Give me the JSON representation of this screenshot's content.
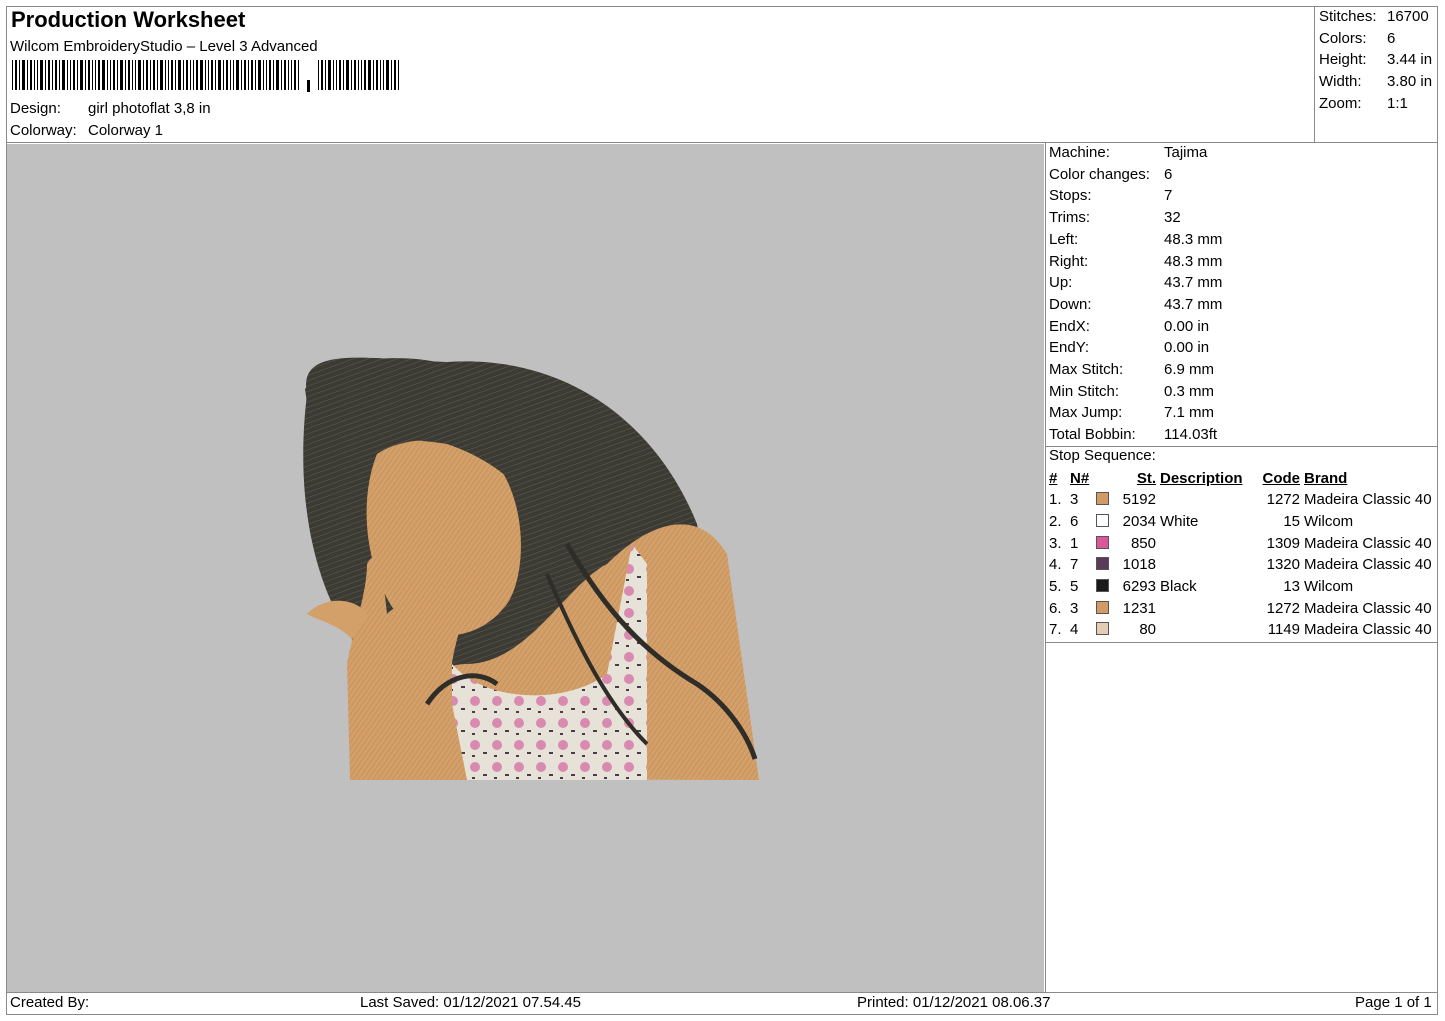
{
  "header": {
    "title": "Production Worksheet",
    "software": "Wilcom EmbroideryStudio – Level 3 Advanced",
    "design_label": "Design:",
    "design_value": "girl photoflat 3,8 in",
    "colorway_label": "Colorway:",
    "colorway_value": "Colorway 1"
  },
  "stats": [
    {
      "label": "Stitches:",
      "value": "16700"
    },
    {
      "label": "Colors:",
      "value": "6"
    },
    {
      "label": "Height:",
      "value": "3.44 in"
    },
    {
      "label": "Width:",
      "value": "3.80 in"
    },
    {
      "label": "Zoom:",
      "value": "1:1"
    }
  ],
  "machine_info": [
    {
      "label": "Machine:",
      "value": "Tajima"
    },
    {
      "label": "Color changes:",
      "value": "6"
    },
    {
      "label": "Stops:",
      "value": "7"
    },
    {
      "label": "Trims:",
      "value": "32"
    },
    {
      "label": "Left:",
      "value": "48.3 mm"
    },
    {
      "label": "Right:",
      "value": "48.3 mm"
    },
    {
      "label": "Up:",
      "value": "43.7 mm"
    },
    {
      "label": "Down:",
      "value": "43.7 mm"
    },
    {
      "label": "EndX:",
      "value": "0.00 in"
    },
    {
      "label": "EndY:",
      "value": "0.00 in"
    },
    {
      "label": "Max Stitch:",
      "value": "6.9 mm"
    },
    {
      "label": "Min Stitch:",
      "value": "0.3 mm"
    },
    {
      "label": "Max Jump:",
      "value": "7.1 mm"
    },
    {
      "label": "Total Bobbin:",
      "value": "114.03ft"
    }
  ],
  "stop_sequence": {
    "title": "Stop Sequence:",
    "headers": {
      "idx": "#",
      "n": "N#",
      "st": "St.",
      "desc": "Description",
      "code": "Code",
      "brand": "Brand"
    },
    "rows": [
      {
        "idx": "1.",
        "n": "3",
        "color": "#d49a66",
        "st": "5192",
        "desc": "",
        "code": "1272",
        "brand": "Madeira Classic 40"
      },
      {
        "idx": "2.",
        "n": "6",
        "color": "#ffffff",
        "st": "2034",
        "desc": "White",
        "code": "15",
        "brand": "Wilcom"
      },
      {
        "idx": "3.",
        "n": "1",
        "color": "#d9589a",
        "st": "850",
        "desc": "",
        "code": "1309",
        "brand": "Madeira Classic 40"
      },
      {
        "idx": "4.",
        "n": "7",
        "color": "#5a3c5a",
        "st": "1018",
        "desc": "",
        "code": "1320",
        "brand": "Madeira Classic 40"
      },
      {
        "idx": "5.",
        "n": "5",
        "color": "#1a1a1a",
        "st": "6293",
        "desc": "Black",
        "code": "13",
        "brand": "Wilcom"
      },
      {
        "idx": "6.",
        "n": "3",
        "color": "#d49a66",
        "st": "1231",
        "desc": "",
        "code": "1272",
        "brand": "Madeira Classic 40"
      },
      {
        "idx": "7.",
        "n": "4",
        "color": "#e3cdb4",
        "st": "80",
        "desc": "",
        "code": "1149",
        "brand": "Madeira Classic 40"
      }
    ]
  },
  "footer": {
    "created_by": "Created By:",
    "last_saved": "Last Saved: 01/12/2021 07.54.45",
    "printed": "Printed: 01/12/2021 08.06.37",
    "page": "Page 1 of 1"
  }
}
